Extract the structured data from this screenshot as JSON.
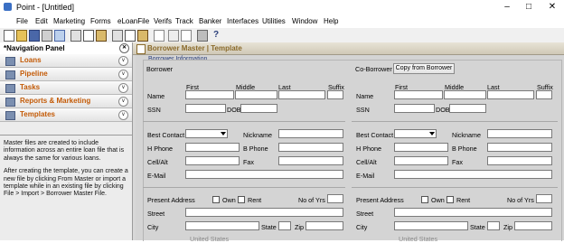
{
  "window": {
    "title": "Point - [Untitled]"
  },
  "menu": [
    "File",
    "Edit",
    "Marketing",
    "Forms",
    "eLoanFile",
    "Verifs",
    "Track",
    "Banker",
    "Interfaces",
    "Utilities",
    "Window",
    "Help"
  ],
  "nav": {
    "title": "*Navigation Panel",
    "items": [
      {
        "label": "Loans"
      },
      {
        "label": "Pipeline"
      },
      {
        "label": "Tasks"
      },
      {
        "label": "Reports & Marketing"
      },
      {
        "label": "Templates"
      }
    ],
    "help_p1": "Master files are created to include information across an entire loan file that is always the same for various loans.",
    "help_p2": "After creating the template, you can create a new file by clicking From Master or import a template while in an existing file by clicking File > Import > Borrower Master File."
  },
  "main": {
    "header": "Borrower Master | Template",
    "section_title": "Borrower Information",
    "borrower_label": "Borrower",
    "coborrower_label": "Co-Borrower",
    "copy_button": "Copy from Borrower",
    "fields": {
      "first": "First",
      "middle": "Middle",
      "last": "Last",
      "suffix": "Suffix",
      "name": "Name",
      "ssn": "SSN",
      "dob": "DOB",
      "best_contact": "Best Contact",
      "nickname": "Nickname",
      "h_phone": "H Phone",
      "b_phone": "B Phone",
      "cell": "Cell/Alt",
      "fax": "Fax",
      "email": "E-Mail",
      "present_address": "Present Address",
      "own": "Own",
      "rent": "Rent",
      "no_of_yrs": "No of Yrs",
      "street": "Street",
      "city": "City",
      "state": "State",
      "zip": "Zip",
      "country": "United States"
    }
  }
}
